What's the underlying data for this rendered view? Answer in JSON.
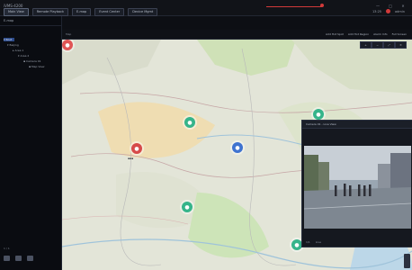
{
  "app": {
    "title": "iVMS-4200"
  },
  "tabs": [
    {
      "label": "Main View"
    },
    {
      "label": "Remote Playback"
    },
    {
      "label": "E-map"
    },
    {
      "label": "Event Center"
    },
    {
      "label": "Device Mgmt"
    }
  ],
  "header": {
    "user_label": "admin",
    "time_label": "13:25"
  },
  "sidebar": {
    "title": "E-map",
    "tree": [
      "Root",
      "Beijing",
      "Area 1",
      "Area 2",
      "Camera 01",
      "Map View"
    ],
    "pager": "1 / 1"
  },
  "subbar": {
    "label": "Map",
    "actions": [
      "Add Hot Spot",
      "Add Hot Region",
      "Alarm Info",
      "Full Screen"
    ]
  },
  "map": {
    "tools": [
      "+",
      "−",
      "⤢",
      "✕"
    ],
    "markers": [
      {
        "type": "alarm",
        "color": "#e05555",
        "icon": "camera-icon"
      },
      {
        "type": "alarm",
        "color": "#d64a4a",
        "icon": "camera-icon"
      },
      {
        "type": "normal",
        "color": "#35b48a",
        "icon": "camera-icon"
      },
      {
        "type": "selected",
        "color": "#3f73d0",
        "icon": "camera-icon"
      },
      {
        "type": "normal",
        "color": "#35b48a",
        "icon": "camera-icon"
      },
      {
        "type": "normal",
        "color": "#35b48a",
        "icon": "camera-icon"
      },
      {
        "type": "normal",
        "color": "#35b48a",
        "icon": "camera-icon"
      }
    ]
  },
  "video": {
    "title": "Camera 01 - Live View",
    "footer": [
      "1/1",
      "Live"
    ]
  },
  "colors": {
    "accent": "#3f73d0",
    "alarm": "#e05555",
    "ok": "#35b48a"
  }
}
